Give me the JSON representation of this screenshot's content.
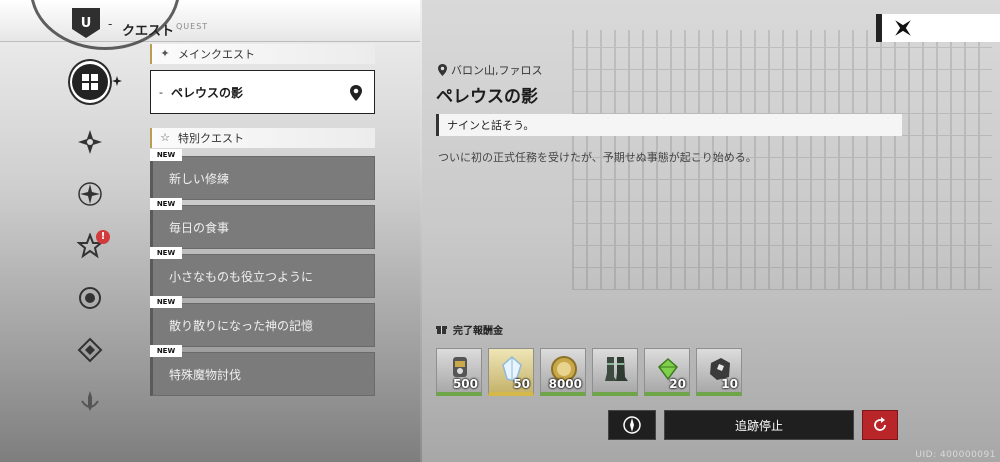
{
  "header": {
    "title": "クエスト",
    "subtitle": "QUEST",
    "emblem": "U"
  },
  "nav": {
    "items": [
      {
        "name": "main-quest-tab",
        "icon": "grid-icon",
        "active": true
      },
      {
        "name": "quest-type-2",
        "icon": "compass-star-icon"
      },
      {
        "name": "quest-type-3",
        "icon": "four-point-star-icon"
      },
      {
        "name": "quest-type-4",
        "icon": "star-outline-icon",
        "alert": "!"
      },
      {
        "name": "quest-type-5",
        "icon": "ring-icon"
      },
      {
        "name": "quest-type-6",
        "icon": "diamond-icon"
      },
      {
        "name": "quest-type-7",
        "icon": "sword-crest-icon"
      }
    ]
  },
  "sections": {
    "main": {
      "label": "メインクエスト"
    },
    "special": {
      "label": "特別クエスト"
    }
  },
  "main_quest": {
    "title": "ペレウスの影"
  },
  "special_quests": [
    {
      "badge": "NEW",
      "title": "新しい修練"
    },
    {
      "badge": "NEW",
      "title": "毎日の食事"
    },
    {
      "badge": "NEW",
      "title": "小さなものも役立つように"
    },
    {
      "badge": "NEW",
      "title": "散り散りになった神の記憶"
    },
    {
      "badge": "NEW",
      "title": "特殊魔物討伐"
    }
  ],
  "detail": {
    "location": "バロン山,ファロス",
    "title": "ペレウスの影",
    "objective": "ナインと話そう。",
    "description": "ついに初の正式任務を受けたが、予期せぬ事態が起こり始める。",
    "reward_label": "完了報酬金",
    "rewards": [
      {
        "icon": "gauntlet-icon",
        "count": "500",
        "tier": "green"
      },
      {
        "icon": "crystal-shard-icon",
        "count": "50",
        "tier": "gold"
      },
      {
        "icon": "gold-coin-icon",
        "count": "8000",
        "tier": "green"
      },
      {
        "icon": "boots-icon",
        "count": "",
        "tier": "green"
      },
      {
        "icon": "green-gem-icon",
        "count": "20",
        "tier": "green"
      },
      {
        "icon": "ore-icon",
        "count": "10",
        "tier": "green"
      }
    ]
  },
  "actions": {
    "stop_tracking": "追跡停止"
  },
  "footer": {
    "uid": "UID: 400000091"
  },
  "colors": {
    "accent_gold": "#b99d57",
    "reset_red": "#b8262a",
    "card_gray": "#7b7b7b"
  }
}
